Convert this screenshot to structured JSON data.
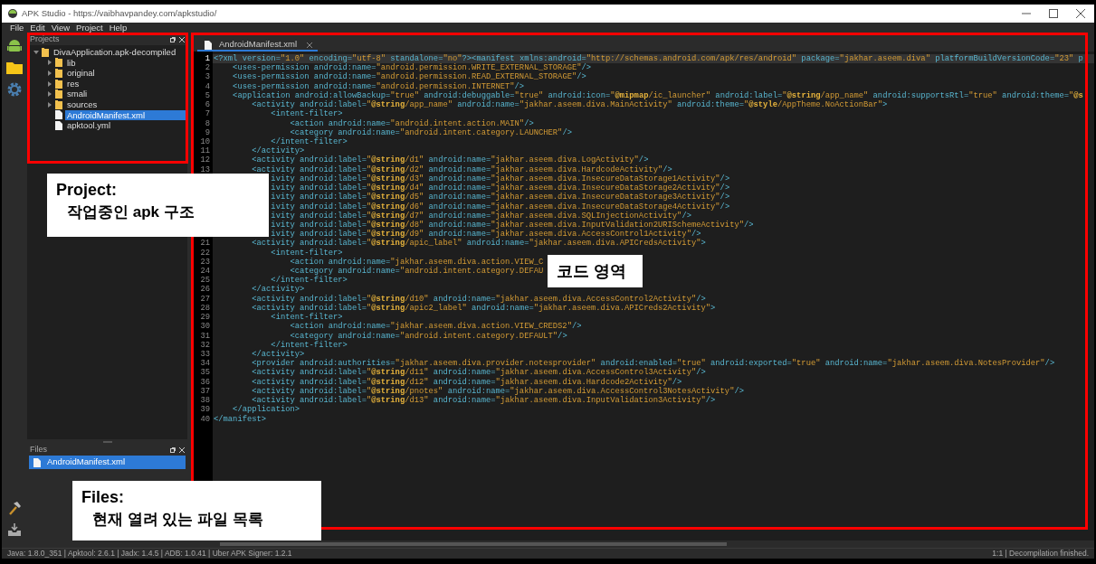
{
  "window": {
    "title": "APK Studio - https://vaibhavpandey.com/apkstudio/"
  },
  "menu": [
    "File",
    "Edit",
    "View",
    "Project",
    "Help"
  ],
  "projects_panel": {
    "title": "Projects",
    "tree": [
      {
        "label": "DivaApplication.apk-decompiled",
        "kind": "folder",
        "expanded": true,
        "selected": false,
        "children": [
          {
            "label": "lib",
            "kind": "folder",
            "expanded": false,
            "selected": false
          },
          {
            "label": "original",
            "kind": "folder",
            "expanded": false,
            "selected": false
          },
          {
            "label": "res",
            "kind": "folder",
            "expanded": false,
            "selected": false
          },
          {
            "label": "smali",
            "kind": "folder",
            "expanded": false,
            "selected": false
          },
          {
            "label": "sources",
            "kind": "folder",
            "expanded": false,
            "selected": false
          },
          {
            "label": "AndroidManifest.xml",
            "kind": "file",
            "selected": true
          },
          {
            "label": "apktool.yml",
            "kind": "file",
            "selected": false
          }
        ]
      }
    ]
  },
  "files_panel": {
    "title": "Files",
    "items": [
      {
        "label": "AndroidManifest.xml",
        "selected": true
      }
    ]
  },
  "editor": {
    "tabs": [
      {
        "label": "AndroidManifest.xml",
        "selected": true
      }
    ],
    "lines": [
      {
        "number": "1",
        "current": true,
        "text": "<?xml version=\"1.0\" encoding=\"utf-8\" standalone=\"no\"?><manifest xmlns:android=\"http://schemas.android.com/apk/res/android\" package=\"jakhar.aseem.diva\" platformBuildVersionCode=\"23\" p"
      },
      {
        "number": "2",
        "current": false,
        "text": "    <uses-permission android:name=\"android.permission.WRITE_EXTERNAL_STORAGE\"/>"
      },
      {
        "number": "3",
        "current": false,
        "text": "    <uses-permission android:name=\"android.permission.READ_EXTERNAL_STORAGE\"/>"
      },
      {
        "number": "4",
        "current": false,
        "text": "    <uses-permission android:name=\"android.permission.INTERNET\"/>"
      },
      {
        "number": "5",
        "current": false,
        "text": "    <application android:allowBackup=\"true\" android:debuggable=\"true\" android:icon=\"@mipmap/ic_launcher\" android:label=\"@string/app_name\" android:supportsRtl=\"true\" android:theme=\"@s"
      },
      {
        "number": "6",
        "current": false,
        "text": "        <activity android:label=\"@string/app_name\" android:name=\"jakhar.aseem.diva.MainActivity\" android:theme=\"@style/AppTheme.NoActionBar\">"
      },
      {
        "number": "7",
        "current": false,
        "text": "            <intent-filter>"
      },
      {
        "number": "8",
        "current": false,
        "text": "                <action android:name=\"android.intent.action.MAIN\"/>"
      },
      {
        "number": "9",
        "current": false,
        "text": "                <category android:name=\"android.intent.category.LAUNCHER\"/>"
      },
      {
        "number": "10",
        "current": false,
        "text": "            </intent-filter>"
      },
      {
        "number": "11",
        "current": false,
        "text": "        </activity>"
      },
      {
        "number": "12",
        "current": false,
        "text": "        <activity android:label=\"@string/d1\" android:name=\"jakhar.aseem.diva.LogActivity\"/>"
      },
      {
        "number": "13",
        "current": false,
        "text": "        <activity android:label=\"@string/d2\" android:name=\"jakhar.aseem.diva.HardcodeActivity\"/>"
      },
      {
        "current": false,
        "text": "            ivity android:label=\"@string/d3\" android:name=\"jakhar.aseem.diva.InsecureDataStorage1Activity\"/>"
      },
      {
        "current": false,
        "text": "            ivity android:label=\"@string/d4\" android:name=\"jakhar.aseem.diva.InsecureDataStorage2Activity\"/>"
      },
      {
        "current": false,
        "text": "            ivity android:label=\"@string/d5\" android:name=\"jakhar.aseem.diva.InsecureDataStorage3Activity\"/>"
      },
      {
        "current": false,
        "text": "            ivity android:label=\"@string/d6\" android:name=\"jakhar.aseem.diva.InsecureDataStorage4Activity\"/>"
      },
      {
        "current": false,
        "text": "            ivity android:label=\"@string/d7\" android:name=\"jakhar.aseem.diva.SQLInjectionActivity\"/>"
      },
      {
        "current": false,
        "text": "            ivity android:label=\"@string/d8\" android:name=\"jakhar.aseem.diva.InputValidation2URISchemeActivity\"/>"
      },
      {
        "current": false,
        "text": "            ivity android:label=\"@string/d9\" android:name=\"jakhar.aseem.diva.AccessControl1Activity\"/>"
      },
      {
        "number": "21",
        "current": false,
        "text": "        <activity android:label=\"@string/apic_label\" android:name=\"jakhar.aseem.diva.APICredsActivity\">"
      },
      {
        "number": "22",
        "current": false,
        "text": "            <intent-filter>"
      },
      {
        "number": "23",
        "current": false,
        "text": "                <action android:name=\"jakhar.aseem.diva.action.VIEW_C"
      },
      {
        "number": "24",
        "current": false,
        "text": "                <category android:name=\"android.intent.category.DEFAU"
      },
      {
        "number": "25",
        "current": false,
        "text": "            </intent-filter>"
      },
      {
        "number": "26",
        "current": false,
        "text": "        </activity>"
      },
      {
        "number": "27",
        "current": false,
        "text": "        <activity android:label=\"@string/d10\" android:name=\"jakhar.aseem.diva.AccessControl2Activity\"/>"
      },
      {
        "number": "28",
        "current": false,
        "text": "        <activity android:label=\"@string/apic2_label\" android:name=\"jakhar.aseem.diva.APICreds2Activity\">"
      },
      {
        "number": "29",
        "current": false,
        "text": "            <intent-filter>"
      },
      {
        "number": "30",
        "current": false,
        "text": "                <action android:name=\"jakhar.aseem.diva.action.VIEW_CREDS2\"/>"
      },
      {
        "number": "31",
        "current": false,
        "text": "                <category android:name=\"android.intent.category.DEFAULT\"/>"
      },
      {
        "number": "32",
        "current": false,
        "text": "            </intent-filter>"
      },
      {
        "number": "33",
        "current": false,
        "text": "        </activity>"
      },
      {
        "number": "34",
        "current": false,
        "text": "        <provider android:authorities=\"jakhar.aseem.diva.provider.notesprovider\" android:enabled=\"true\" android:exported=\"true\" android:name=\"jakhar.aseem.diva.NotesProvider\"/>"
      },
      {
        "number": "35",
        "current": false,
        "text": "        <activity android:label=\"@string/d11\" android:name=\"jakhar.aseem.diva.AccessControl3Activity\"/>"
      },
      {
        "number": "36",
        "current": false,
        "text": "        <activity android:label=\"@string/d12\" android:name=\"jakhar.aseem.diva.Hardcode2Activity\"/>"
      },
      {
        "number": "37",
        "current": false,
        "text": "        <activity android:label=\"@string/pnotes\" android:name=\"jakhar.aseem.diva.AccessControl3NotesActivity\"/>"
      },
      {
        "number": "38",
        "current": false,
        "text": "        <activity android:label=\"@string/d13\" android:name=\"jakhar.aseem.diva.InputValidation3Activity\"/>"
      },
      {
        "number": "39",
        "current": false,
        "text": "    </application>"
      },
      {
        "number": "40",
        "current": false,
        "text": "</manifest>"
      }
    ]
  },
  "status_bar": {
    "left": "Java: 1.8.0_351 | Apktool: 2.6.1 | Jadx: 1.4.5 | ADB: 1.0.41 | Uber APK Signer: 1.2.1",
    "right": "1:1 | Decompilation finished."
  },
  "annotations": [
    {
      "kind": "callout",
      "title": "Project:",
      "text": "작업중인 apk 구조"
    },
    {
      "kind": "callout",
      "text": "코드 영역"
    },
    {
      "kind": "callout",
      "title": "Files:",
      "text": "현재 열려 있는 파일 목록"
    }
  ]
}
